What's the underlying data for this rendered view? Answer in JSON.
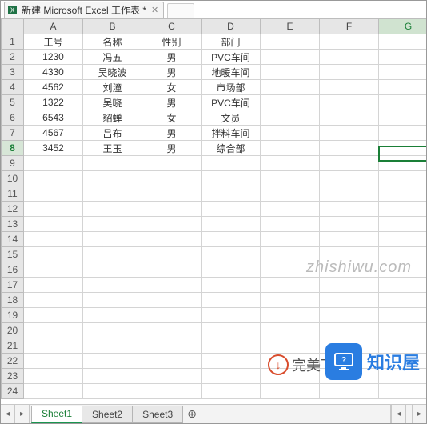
{
  "file_tab": {
    "title": "新建 Microsoft Excel 工作表 *"
  },
  "columns": [
    "A",
    "B",
    "C",
    "D",
    "E",
    "F",
    "G"
  ],
  "row_count": 24,
  "active_row": 8,
  "active_col": "G",
  "headers": [
    "工号",
    "名称",
    "性别",
    "部门"
  ],
  "rows": [
    [
      "1230",
      "冯五",
      "男",
      "PVC车间"
    ],
    [
      "4330",
      "吴晓波",
      "男",
      "地暖车间"
    ],
    [
      "4562",
      "刘潼",
      "女",
      "市场部"
    ],
    [
      "1322",
      "吴晓",
      "男",
      "PVC车间"
    ],
    [
      "6543",
      "貂蝉",
      "女",
      "文员"
    ],
    [
      "4567",
      "吕布",
      "男",
      "拌料车间"
    ],
    [
      "3452",
      "王玉",
      "男",
      "综合部"
    ]
  ],
  "sheets": {
    "tabs": [
      "Sheet1",
      "Sheet2",
      "Sheet3"
    ],
    "active": 0
  },
  "watermark": "zhishiwu.com",
  "brand1": "完美下载",
  "brand2": "知识屋"
}
